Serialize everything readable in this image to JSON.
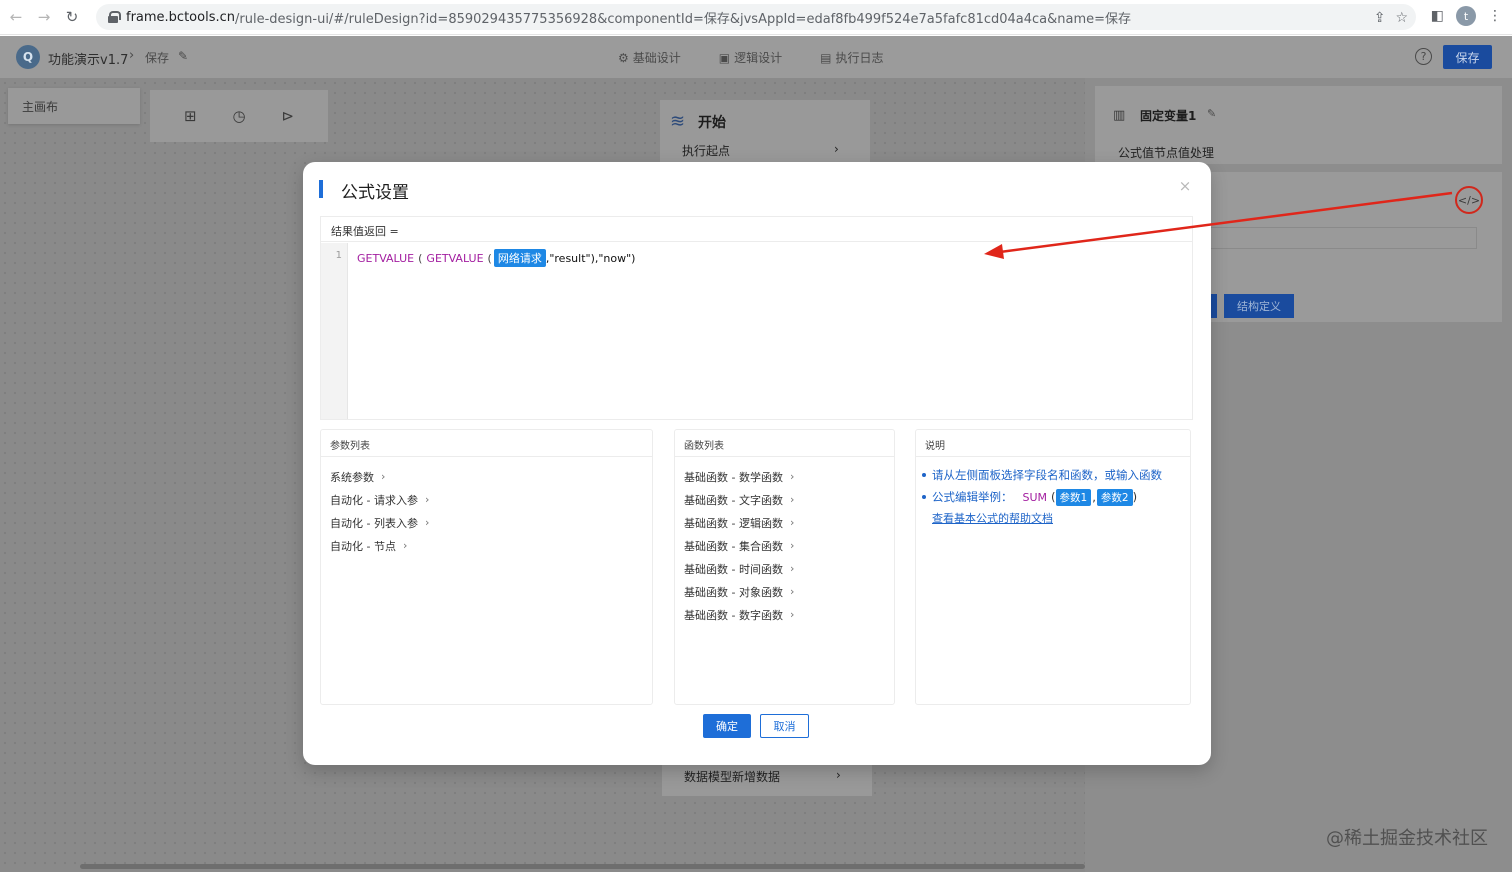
{
  "browser": {
    "url_domain": "frame.bctools.cn",
    "url_rest": "/rule-design-ui/#/ruleDesign?id=859029435775356928&componentId=保存&jvsAppId=edaf8fb499f524e7a5fafc81cd04a4ca&name=保存",
    "profile_initial": "t"
  },
  "app": {
    "title": "功能演示v1.7",
    "breadcrumb": "保存",
    "nav": [
      {
        "label": "基础设计"
      },
      {
        "label": "逻辑设计"
      },
      {
        "label": "执行日志"
      }
    ],
    "help": "?",
    "save_label": "保存"
  },
  "canvas": {
    "tab_label": "主画布",
    "start_node_title": "开始",
    "start_node_row": "执行起点",
    "bottom_node_row": "数据模型新增数据"
  },
  "right_panel": {
    "title": "固定变量1",
    "subtitle": "公式值节点值处理",
    "code_button": "</>",
    "struct_button": "结构定义"
  },
  "modal": {
    "title": "公式设置",
    "close": "×",
    "editor": {
      "header": "结果值返回  =",
      "line_number": "1",
      "fn1": "GETVALUE",
      "paren1": "(",
      "fn2": "GETVALUE",
      "paren2": "(",
      "tag": "网络请求",
      "tail": ",\"result\"),\"now\")"
    },
    "params": {
      "header": "参数列表",
      "items": [
        "系统参数",
        "自动化 - 请求入参",
        "自动化 - 列表入参",
        "自动化 - 节点"
      ]
    },
    "functions": {
      "header": "函数列表",
      "items": [
        "基础函数 - 数学函数",
        "基础函数 - 文字函数",
        "基础函数 - 逻辑函数",
        "基础函数 - 集合函数",
        "基础函数 - 时间函数",
        "基础函数 - 对象函数",
        "基础函数 - 数字函数"
      ]
    },
    "description": {
      "header": "说明",
      "line1": "请从左侧面板选择字段名和函数，或输入函数",
      "line2_prefix": "公式编辑举例：",
      "line2_fn": "SUM",
      "line2_open": "(",
      "param1": "参数1",
      "sep": ",",
      "param2": "参数2",
      "line2_close": ")",
      "link": "查看基本公式的帮助文档"
    },
    "ok_label": "确定",
    "cancel_label": "取消"
  },
  "watermark": "@稀土掘金技术社区",
  "colors": {
    "primary": "#1e6ed8",
    "tag": "#1e88e5",
    "function": "#a31ea0",
    "annotation": "#e0261a"
  }
}
